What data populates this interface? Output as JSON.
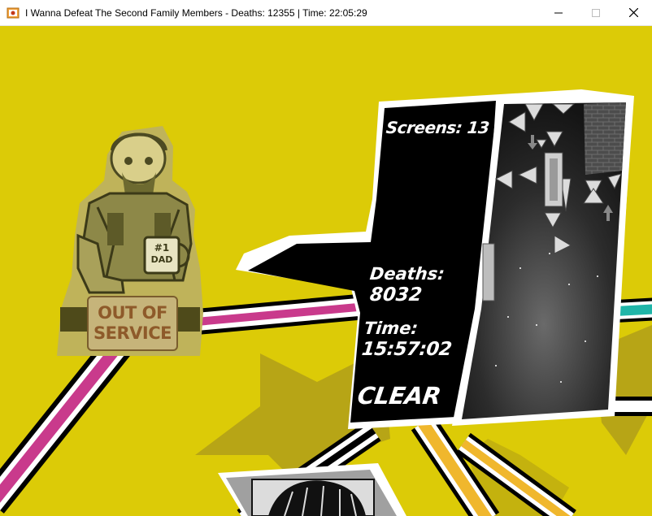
{
  "window": {
    "title": "I Wanna Defeat The Second Family Members - Deaths: 12355 | Time: 22:05:29",
    "icon": "game-window-icon",
    "controls": [
      "minimize-icon",
      "maximize-icon",
      "close-icon"
    ]
  },
  "stage_card": {
    "screens_text": "Screens: 13",
    "deaths_label": "Deaths:",
    "deaths_value": "8032",
    "time_label": "Time:",
    "time_value": "15:57:02",
    "status": "CLEAR"
  },
  "character": {
    "sign_line1": "OUT OF",
    "sign_line2": "SERVICE",
    "mug_text": "#1 DAD"
  },
  "colors": {
    "background": "#dccb07",
    "pink_path": "#c93a8c",
    "teal_path": "#1fb5a8",
    "orange_path": "#f0b72d",
    "card_black": "#000000",
    "sign_text": "#8e5a2a"
  }
}
